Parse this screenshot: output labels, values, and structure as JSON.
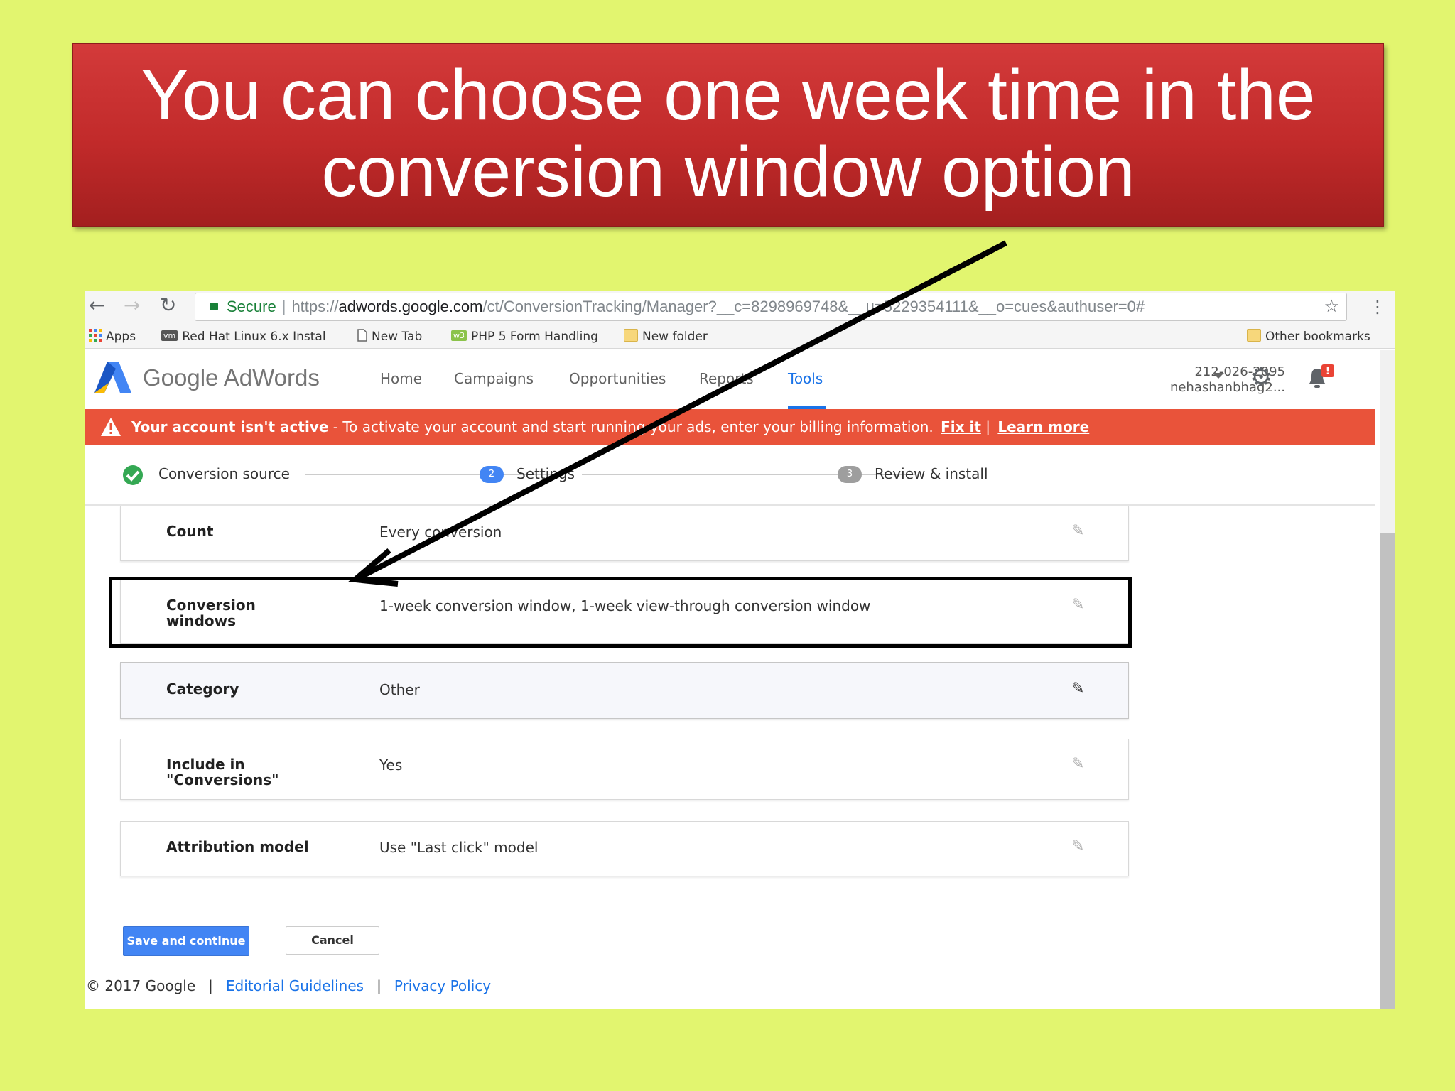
{
  "slide": {
    "title_line1": "You can choose one week time in the",
    "title_line2": "conversion window option"
  },
  "browser": {
    "secure_label": "Secure",
    "url_scheme": "https://",
    "url_host": "adwords.google.com",
    "url_path": "/ct/ConversionTracking/Manager?__c=8298969748&__u=5229354111&__o=cues&authuser=0#",
    "bookmarks": [
      "Apps",
      "Red Hat Linux 6.x Instal",
      "New Tab",
      "PHP 5 Form Handling",
      "New folder"
    ],
    "other_bookmarks": "Other bookmarks"
  },
  "header": {
    "logo_text": "Google AdWords",
    "nav": [
      "Home",
      "Campaigns",
      "Opportunities",
      "Reports",
      "Tools"
    ],
    "active_nav": "Tools",
    "account_phone": "212-026-2095",
    "account_user": "nehashanbhag2...",
    "notification_badge": "!"
  },
  "alert": {
    "bold_text": "Your account isn't active",
    "message": " - To activate your account and start running your ads, enter your billing information.",
    "fix_link": "Fix it",
    "separator": "|",
    "learn_link": "Learn more"
  },
  "stepper": {
    "steps": [
      {
        "number": "",
        "label": "Conversion source",
        "state": "done"
      },
      {
        "number": "2",
        "label": "Settings",
        "state": "active"
      },
      {
        "number": "3",
        "label": "Review & install",
        "state": "pending"
      }
    ]
  },
  "settings": {
    "rows": [
      {
        "label": "Count",
        "value": "Every conversion"
      },
      {
        "label": "Conversion windows",
        "value": "1-week conversion window, 1-week view-through conversion window"
      },
      {
        "label": "Category",
        "value": "Other"
      },
      {
        "label": "Include in \"Conversions\"",
        "value": "Yes"
      },
      {
        "label": "Attribution model",
        "value": "Use \"Last click\" model"
      }
    ]
  },
  "actions": {
    "save_label": "Save and continue",
    "cancel_label": "Cancel"
  },
  "footer": {
    "copyright": "© 2017 Google",
    "sep": "|",
    "editorial": "Editorial Guidelines",
    "privacy": "Privacy Policy"
  },
  "colors": {
    "slide_bg": "#e2f56f",
    "banner_red": "#c12a2a",
    "alert_red": "#e9533a",
    "link_blue": "#1a73e8",
    "step_done_green": "#34a853"
  }
}
